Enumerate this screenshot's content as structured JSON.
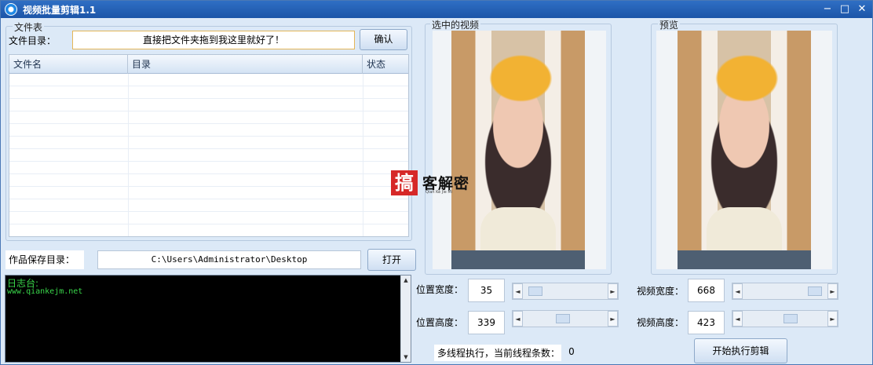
{
  "window": {
    "title": "视频批量剪辑1.1",
    "controls": [
      "−",
      "□",
      "✕"
    ]
  },
  "file_table": {
    "group_title": "文件表",
    "dir_label": "文件目录：",
    "dir_value": "直接把文件夹拖到我这里就好了！",
    "confirm_label": "确认",
    "columns": [
      "文件名",
      "目录",
      "状态"
    ]
  },
  "save": {
    "label": "作品保存目录：",
    "path": "C:\\Users\\Administrator\\Desktop",
    "open_label": "打开"
  },
  "log": {
    "title": "日志台:",
    "line": "www.qiankejm.net"
  },
  "selected_video": {
    "group_title": "选中的视频"
  },
  "preview": {
    "group_title": "预览"
  },
  "watermark": {
    "badge": "搞",
    "text": "客解密",
    "sub": "Qian Ke Jie Mi"
  },
  "position": {
    "width_label": "位置宽度：",
    "width_value": "35",
    "height_label": "位置高度：",
    "height_value": "339"
  },
  "video_size": {
    "width_label": "视频宽度：",
    "width_value": "668",
    "height_label": "视频高度：",
    "height_value": "423"
  },
  "threads": {
    "label": "多线程执行，当前线程条数：",
    "count": "0"
  },
  "start_button": "开始执行剪辑",
  "colors": {
    "background": "#dce9f7",
    "titlebar": "#1c55a8",
    "log_text": "#39d64a",
    "console_bg": "#000000"
  }
}
